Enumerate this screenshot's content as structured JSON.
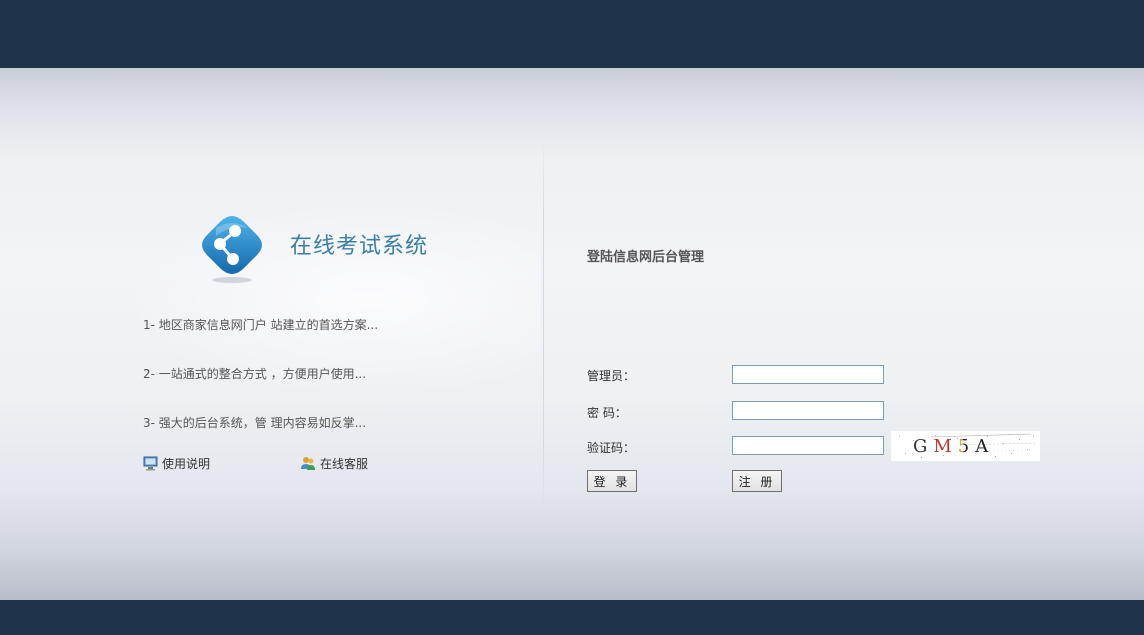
{
  "app": {
    "title": "在线考试系统"
  },
  "features": [
    "1- 地区商家信息网门户 站建立的首选方案...",
    "2- 一站通式的整合方式 ，方便用户使用...",
    "3- 强大的后台系统，管 理内容易如反掌..."
  ],
  "links": {
    "manual": "使用说明",
    "support": "在线客服"
  },
  "login": {
    "heading": "登陆信息网后台管理",
    "admin_label": "管理员：",
    "password_label": "密 码：",
    "captcha_label": "验证码：",
    "admin_value": "",
    "password_value": "",
    "captcha_value": "",
    "captcha_text": "GM5A",
    "login_button": "登 录",
    "register_button": "注 册"
  },
  "colors": {
    "header_bar": "#1f344b",
    "footer_bar": "#1f344b",
    "title_blue": "#3c7fa6",
    "logo_blue": "#1e86c9"
  },
  "icons": {
    "logo": "share-logo-icon",
    "manual": "monitor-icon",
    "support": "users-icon"
  }
}
